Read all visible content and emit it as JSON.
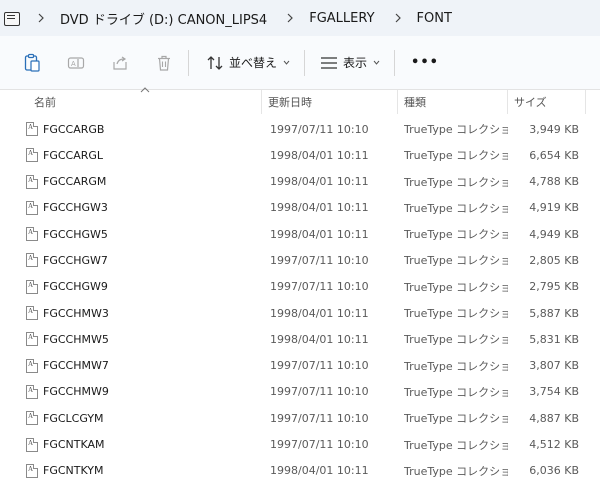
{
  "breadcrumb": {
    "items": [
      "DVD ドライブ (D:) CANON_LIPS4",
      "FGALLERY",
      "FONT"
    ]
  },
  "toolbar": {
    "sort_label": "並べ替え",
    "view_label": "表示",
    "more_label": "•••",
    "icons": [
      "clipboard-icon",
      "rename-icon",
      "share-icon",
      "delete-icon",
      "sort-icon",
      "view-icon",
      "more-icon"
    ]
  },
  "columns": {
    "name": "名前",
    "date": "更新日時",
    "type": "種類",
    "size": "サイズ"
  },
  "files": [
    {
      "name": "FGCCARGB",
      "date": "1997/07/11 10:10",
      "type": "TrueType コレクショ...",
      "size": "3,949 KB"
    },
    {
      "name": "FGCCARGL",
      "date": "1998/04/01 10:11",
      "type": "TrueType コレクショ...",
      "size": "6,654 KB"
    },
    {
      "name": "FGCCARGM",
      "date": "1998/04/01 10:11",
      "type": "TrueType コレクショ...",
      "size": "4,788 KB"
    },
    {
      "name": "FGCCHGW3",
      "date": "1998/04/01 10:11",
      "type": "TrueType コレクショ...",
      "size": "4,919 KB"
    },
    {
      "name": "FGCCHGW5",
      "date": "1998/04/01 10:11",
      "type": "TrueType コレクショ...",
      "size": "4,949 KB"
    },
    {
      "name": "FGCCHGW7",
      "date": "1997/07/11 10:10",
      "type": "TrueType コレクショ...",
      "size": "2,805 KB"
    },
    {
      "name": "FGCCHGW9",
      "date": "1997/07/11 10:10",
      "type": "TrueType コレクショ...",
      "size": "2,795 KB"
    },
    {
      "name": "FGCCHMW3",
      "date": "1998/04/01 10:11",
      "type": "TrueType コレクショ...",
      "size": "5,887 KB"
    },
    {
      "name": "FGCCHMW5",
      "date": "1998/04/01 10:11",
      "type": "TrueType コレクショ...",
      "size": "5,831 KB"
    },
    {
      "name": "FGCCHMW7",
      "date": "1997/07/11 10:10",
      "type": "TrueType コレクショ...",
      "size": "3,807 KB"
    },
    {
      "name": "FGCCHMW9",
      "date": "1997/07/11 10:10",
      "type": "TrueType コレクショ...",
      "size": "3,754 KB"
    },
    {
      "name": "FGCLCGYM",
      "date": "1997/07/11 10:10",
      "type": "TrueType コレクショ...",
      "size": "4,887 KB"
    },
    {
      "name": "FGCNTKAM",
      "date": "1997/07/11 10:10",
      "type": "TrueType コレクショ...",
      "size": "4,512 KB"
    },
    {
      "name": "FGCNTKYM",
      "date": "1998/04/01 10:11",
      "type": "TrueType コレクショ...",
      "size": "6,036 KB"
    }
  ],
  "colors": {
    "breadcrumb_bg": "#eff3f8",
    "toolbar_bg": "#f9fbfd",
    "disabled_icon": "#a8a8a8",
    "accent": "#1a73c9"
  }
}
